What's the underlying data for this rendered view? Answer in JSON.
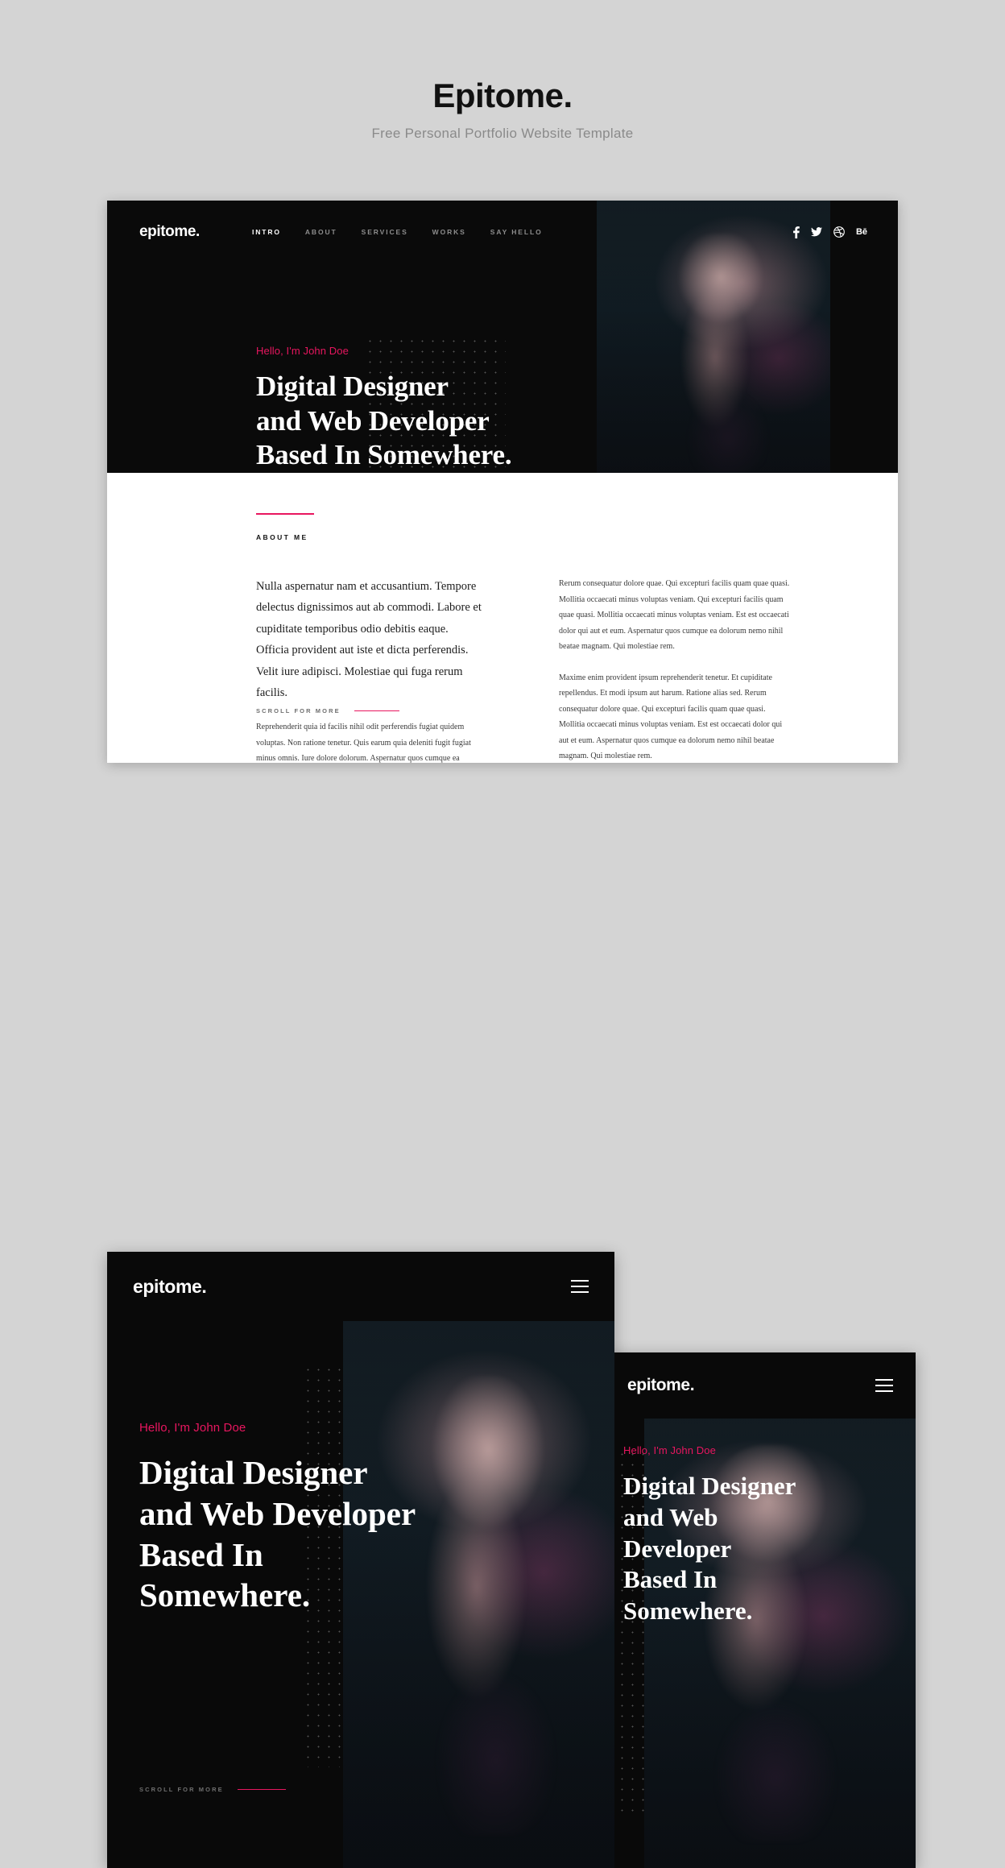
{
  "header": {
    "title": "Epitome.",
    "subtitle": "Free Personal Portfolio Website Template"
  },
  "colors": {
    "accent_pink": "#e8165f",
    "dark_bg": "#0a0a0a",
    "page_bg": "#d4d4d4",
    "light_bg": "#ffffff"
  },
  "site": {
    "logo": "epitome.",
    "nav": [
      {
        "label": "INTRO",
        "active": true
      },
      {
        "label": "ABOUT",
        "active": false
      },
      {
        "label": "SERVICES",
        "active": false
      },
      {
        "label": "WORKS",
        "active": false
      },
      {
        "label": "SAY HELLO",
        "active": false
      }
    ],
    "social": [
      {
        "name": "facebook-icon",
        "glyph": "f"
      },
      {
        "name": "twitter-icon",
        "glyph": "t"
      },
      {
        "name": "dribbble-icon",
        "glyph": "d"
      },
      {
        "name": "behance-icon",
        "glyph": "Bē"
      }
    ],
    "hero": {
      "greeting": "Hello, I'm John Doe",
      "headline_lines": [
        "Digital Designer",
        "and Web Developer",
        "Based In Somewhere."
      ],
      "scroll_label": "SCROLL FOR MORE"
    },
    "about": {
      "kicker": "ABOUT ME",
      "lead": "Nulla aspernatur nam et accusantium. Tempore delectus dignissimos aut ab commodi. Labore et cupiditate temporibus odio debitis eaque. Officia provident aut iste et dicta perferendis. Velit iure adipisci. Molestiae qui fuga rerum facilis.",
      "left_paragraph": "Reprehenderit quia id facilis nihil odit perferendis fugiat quidem voluptas. Non ratione tenetur. Quis earum quia deleniti fugit fugiat minus omnis. Iure dolore dolorum. Aspernatur quos cumque ea dolorum nemo nihil beatae magnam. Qui molestiae",
      "right_paragraph_1": "Rerum consequatur dolore quae. Qui excepturi facilis quam quae quasi. Mollitia occaecati minus voluptas veniam. Qui excepturi facilis quam quae quasi. Mollitia occaecati minus voluptas veniam. Est est occaecati dolor qui aut et eum. Aspernatur quos cumque ea dolorum nemo nihil beatae magnam. Qui molestiae rem.",
      "right_paragraph_2": "Maxime enim provident ipsum reprehenderit tenetur. Et cupiditate repellendus. Et modi ipsum aut harum. Ratione alias sed. Rerum consequatur dolore quae. Qui excepturi facilis quam quae quasi. Mollitia occaecati minus voluptas veniam. Est est occaecati dolor qui aut et eum. Aspernatur quos cumque ea dolorum nemo nihil beatae magnam. Qui molestiae rem."
    },
    "tablet_hero": {
      "greeting": "Hello, I'm John Doe",
      "headline_lines": [
        "Digital Designer",
        "and Web Developer",
        "Based In",
        "Somewhere."
      ],
      "scroll_label": "SCROLL FOR MORE"
    },
    "mobile_hero": {
      "greeting": "Hello, I'm John Doe",
      "headline_lines": [
        "Digital Designer",
        "and Web",
        "Developer",
        "Based In",
        "Somewhere."
      ]
    }
  }
}
